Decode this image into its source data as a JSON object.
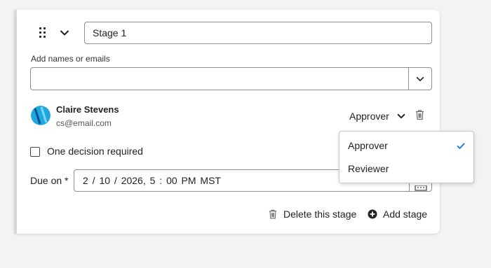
{
  "stage": {
    "name_value": "Stage 1"
  },
  "participants": {
    "label": "Add names or emails",
    "input_value": "",
    "person": {
      "name": "Claire Stevens",
      "email": "cs@email.com",
      "role": "Approver"
    }
  },
  "decision": {
    "checkbox_label": "One decision required",
    "checked": false
  },
  "due": {
    "label": "Due on *",
    "value": "2 / 10 / 2026,  5 : 00  PM  MST"
  },
  "actions": {
    "delete_label": "Delete this stage",
    "add_label": "Add stage"
  },
  "role_menu": {
    "options": [
      "Approver",
      "Reviewer"
    ],
    "selected": "Approver"
  },
  "colors": {
    "accent": "#1473e6",
    "avatar": "#1fa7e0"
  },
  "icons": {
    "drag": "drag-handle-icon",
    "collapse": "chevron-down-icon",
    "delete": "trash-icon",
    "add": "add-circle-icon",
    "calendar": "calendar-icon",
    "selected": "checkmark-icon"
  }
}
